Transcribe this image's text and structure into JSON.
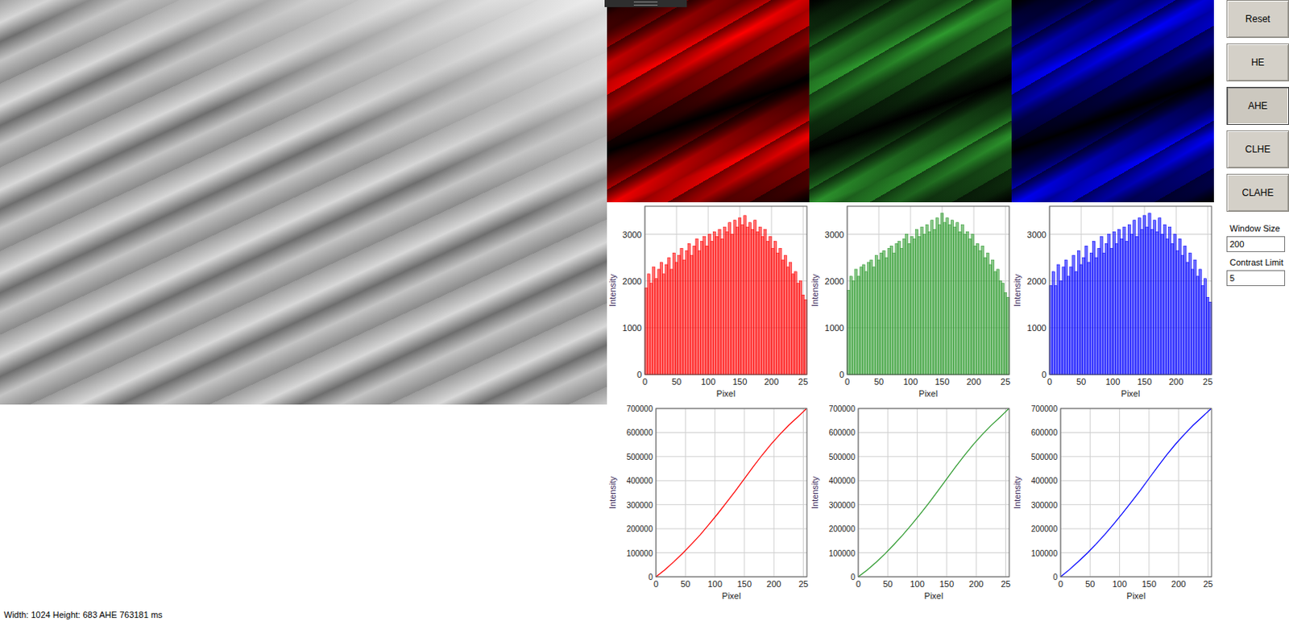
{
  "channels": [
    {
      "color": "#ff0000",
      "histogram": [
        1850,
        2150,
        1950,
        2300,
        2050,
        2250,
        2400,
        2150,
        2350,
        2500,
        2250,
        2600,
        2400,
        2550,
        2700,
        2450,
        2650,
        2800,
        2550,
        2750,
        2900,
        2650,
        2850,
        2950,
        2750,
        3000,
        2850,
        3050,
        2950,
        3100,
        2900,
        3150,
        3050,
        3250,
        3000,
        3300,
        3150,
        3350,
        3200,
        3400,
        3150,
        3250,
        3100,
        3300,
        3050,
        3150,
        2950,
        3100,
        2850,
        2950,
        2700,
        2850,
        2600,
        2700,
        2450,
        2550,
        2300,
        2400,
        2150,
        2200,
        1950,
        2000,
        1700,
        1600
      ],
      "cdf": [
        0,
        29000,
        62000,
        97000,
        135000,
        175000,
        218000,
        263000,
        310000,
        358000,
        408000,
        458000,
        506000,
        551000,
        592000,
        630000,
        664000,
        699000
      ]
    },
    {
      "color": "#2e9a2e",
      "histogram": [
        1800,
        2100,
        2000,
        2250,
        2100,
        2300,
        2350,
        2200,
        2400,
        2450,
        2300,
        2550,
        2450,
        2600,
        2650,
        2500,
        2700,
        2750,
        2600,
        2800,
        2850,
        2700,
        2900,
        3000,
        2800,
        2950,
        2900,
        3100,
        2950,
        3150,
        3000,
        3200,
        3050,
        3300,
        3100,
        3350,
        3200,
        3450,
        3250,
        3350,
        3200,
        3300,
        3150,
        3250,
        3050,
        3200,
        3000,
        3050,
        2900,
        3000,
        2750,
        2800,
        2650,
        2750,
        2500,
        2600,
        2350,
        2450,
        2200,
        2250,
        2000,
        1950,
        1750,
        1650
      ],
      "cdf": [
        0,
        28000,
        60000,
        95000,
        133000,
        173000,
        216000,
        261000,
        308000,
        357000,
        407000,
        457000,
        505000,
        550000,
        591000,
        629000,
        663000,
        699000
      ]
    },
    {
      "color": "#0000ff",
      "histogram": [
        1900,
        2200,
        1900,
        2350,
        2000,
        2300,
        2450,
        2100,
        2300,
        2550,
        2200,
        2650,
        2350,
        2500,
        2750,
        2400,
        2600,
        2850,
        2500,
        2700,
        2950,
        2600,
        2800,
        3000,
        2700,
        3050,
        2800,
        3100,
        2900,
        3150,
        2850,
        3200,
        3000,
        3300,
        2950,
        3350,
        3100,
        3400,
        3150,
        3450,
        3100,
        3300,
        3050,
        3350,
        3000,
        3200,
        2900,
        3150,
        2800,
        3000,
        2650,
        2900,
        2550,
        2750,
        2400,
        2600,
        2250,
        2450,
        2100,
        2250,
        1900,
        2050,
        1650,
        1550
      ],
      "cdf": [
        0,
        30000,
        63000,
        98000,
        136000,
        176000,
        219000,
        264000,
        311000,
        359000,
        409000,
        459000,
        507000,
        552000,
        593000,
        631000,
        665000,
        699000
      ]
    }
  ],
  "histogram_axes": {
    "x_label": "Pixel",
    "y_label": "Intensity",
    "x_ticks": [
      "0",
      "50",
      "100",
      "150",
      "200",
      "25"
    ],
    "y_ticks": [
      "0",
      "1000",
      "2000",
      "3000"
    ]
  },
  "cdf_axes": {
    "x_label": "Pixel",
    "y_label": "Intensity",
    "x_ticks": [
      "0",
      "50",
      "100",
      "150",
      "200",
      "25"
    ],
    "y_ticks": [
      "0",
      "100000",
      "200000",
      "300000",
      "400000",
      "500000",
      "600000",
      "700000"
    ]
  },
  "buttons": [
    {
      "label": "Reset",
      "selected": false
    },
    {
      "label": "HE",
      "selected": false
    },
    {
      "label": "AHE",
      "selected": true
    },
    {
      "label": "CLHE",
      "selected": false
    },
    {
      "label": "CLAHE",
      "selected": false
    }
  ],
  "fields": [
    {
      "label": "Window Size",
      "value": "200"
    },
    {
      "label": "Contrast Limit",
      "value": "5"
    }
  ],
  "status_bar": "Width: 1024 Height: 683 AHE 763181 ms"
}
